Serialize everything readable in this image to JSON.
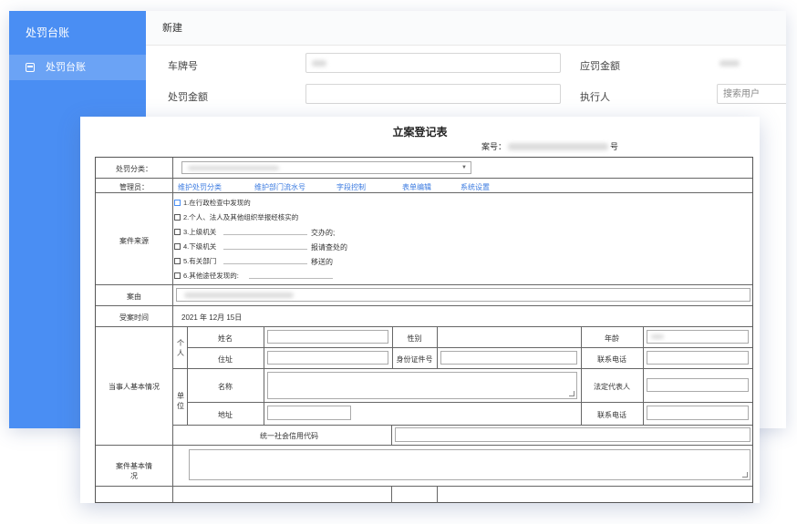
{
  "sidebar": {
    "title": "处罚台账",
    "items": [
      {
        "label": "处罚台账"
      }
    ]
  },
  "main": {
    "header": "新建",
    "fields": {
      "plate_label": "车牌号",
      "fine_due_label": "应罚金额",
      "fine_amount_label": "处罚金额",
      "executor_label": "执行人",
      "executor_placeholder": "搜索用户"
    }
  },
  "doc": {
    "title": "立案登记表",
    "case_no_prefix": "案号：",
    "case_no_suffix": "号",
    "rows": {
      "category_label": "处罚分类：",
      "manager_label": "管理员：",
      "manager_links": [
        "维护处罚分类",
        "维护部门流水号",
        "字段控制",
        "表单编辑",
        "系统设置"
      ],
      "source_label": "案件来源",
      "source_options": [
        "1.在行政检查中发现的",
        "2.个人、法人及其他组织举报经核实的",
        "3.上级机关",
        "4.下级机关",
        "5.有关部门",
        "6.其他途径发现的:"
      ],
      "source_suffixes": [
        "交办的;",
        "报请查处的",
        "移送的"
      ],
      "cause_label": "案由",
      "time_label": "受案时间",
      "time_value": "2021 年 12月 15日",
      "party_label": "当事人基本情况",
      "individual_label": "个人",
      "unit_label": "单位",
      "name_label": "姓名",
      "gender_label": "性别",
      "age_label": "年龄",
      "address_label": "住址",
      "id_label": "身份证件号",
      "phone_label": "联系电话",
      "unit_name_label": "名称",
      "legal_rep_label": "法定代表人",
      "unit_addr_label": "地址",
      "unit_phone_label": "联系电话",
      "credit_code_label": "统一社会信用代码",
      "basic_info_label": "案件基本情况"
    }
  }
}
